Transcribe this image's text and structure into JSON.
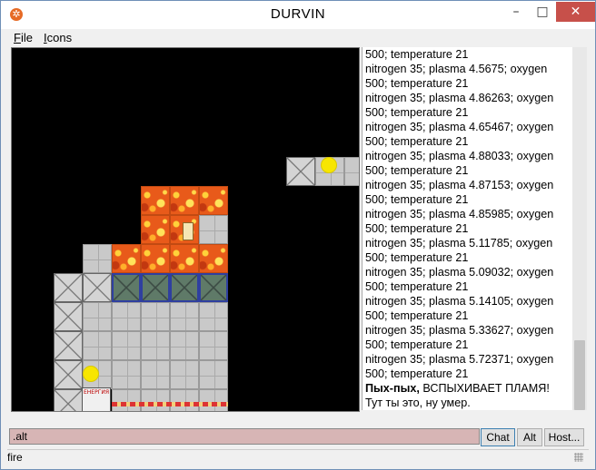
{
  "window": {
    "title": "DURVIN",
    "controls": {
      "minimize": "–",
      "maximize": "□",
      "close": "✕"
    }
  },
  "menu": {
    "items": [
      {
        "accel": "F",
        "rest": "ile"
      },
      {
        "accel": "I",
        "rest": "cons"
      }
    ]
  },
  "log": {
    "lines": [
      "500; temperature 21",
      "nitrogen 35; plasma 4.5675; oxygen",
      "500; temperature 21",
      "nitrogen 35; plasma 4.86263; oxygen",
      "500; temperature 21",
      "nitrogen 35; plasma 4.65467; oxygen",
      "500; temperature 21",
      "nitrogen 35; plasma 4.88033; oxygen",
      "500; temperature 21",
      "nitrogen 35; plasma 4.87153; oxygen",
      "500; temperature 21",
      "nitrogen 35; plasma 4.85985; oxygen",
      "500; temperature 21",
      "nitrogen 35; plasma 5.11785; oxygen",
      "500; temperature 21",
      "nitrogen 35; plasma 5.09032; oxygen",
      "500; temperature 21",
      "nitrogen 35; plasma 5.14105; oxygen",
      "500; temperature 21",
      "nitrogen 35; plasma 5.33627; oxygen",
      "500; temperature 21",
      "nitrogen 35; plasma 5.72371; oxygen",
      "500; temperature 21"
    ],
    "event_bold": "Пых-пых,",
    "event_rest": " ВСПЫХИВАЕТ ПЛАМЯ!",
    "last_line": "Тут ты это, ну умер."
  },
  "map": {
    "sign_text": "ЕНЕРГИЯ"
  },
  "input": {
    "value": ".alt"
  },
  "buttons": {
    "chat": "Chat",
    "alt": "Alt",
    "host": "Host..."
  },
  "status": {
    "text": "fire"
  }
}
